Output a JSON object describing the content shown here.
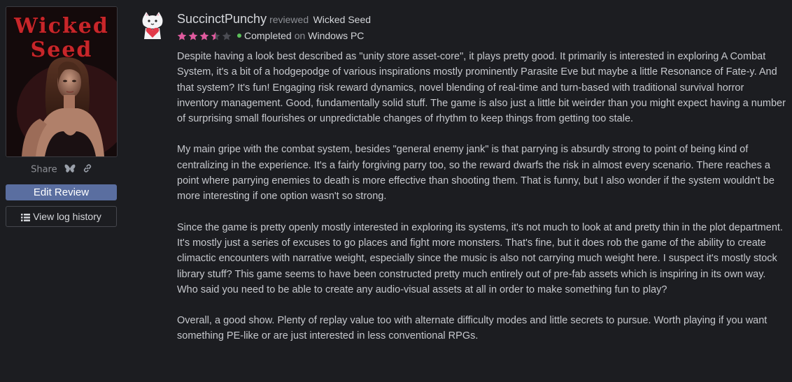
{
  "cover": {
    "title_line1": "Wicked",
    "title_line2": "Seed"
  },
  "share": {
    "label": "Share",
    "icons": [
      "butterfly-icon",
      "link-icon"
    ]
  },
  "actions": {
    "edit_review": "Edit Review",
    "view_log_history": "View log history"
  },
  "review": {
    "username": "SuccinctPunchy",
    "reviewed_label": "reviewed",
    "game": "Wicked Seed",
    "rating": 3.5,
    "rating_max": 5,
    "status": "Completed",
    "on_label": "on",
    "platform": "Windows PC",
    "status_color": "#5cbf5a",
    "star_color": "#e05a9e",
    "paragraphs": [
      "Despite having a look best described as \"unity store asset-core\", it plays pretty good. It primarily is interested in exploring A Combat System, it's a bit of a hodgepodge of various inspirations mostly prominently Parasite Eve but maybe a little Resonance of Fate-y. And that system? It's fun! Engaging risk reward dynamics, novel blending of real-time and turn-based with traditional survival horror inventory management. Good, fundamentally solid stuff. The game is also just a little bit weirder than you might expect having a number of surprising small flourishes or unpredictable changes of rhythm to keep things from getting too stale.",
      "My main gripe with the combat system, besides \"general enemy jank\" is that parrying is absurdly strong to point of being kind of centralizing in the experience. It's a fairly forgiving parry too, so the reward dwarfs the risk in almost every scenario. There reaches a point where parrying enemies to death is more effective than shooting them. That is funny, but I also wonder if the system wouldn't be more interesting if one option wasn't so strong.",
      "Since the game is pretty openly mostly interested in exploring its systems, it's not much to look at and pretty thin in the plot department. It's mostly just a series of excuses to go places and fight more monsters. That's fine, but it does rob the game of the ability to create climactic encounters with narrative weight, especially since the music is also not carrying much weight here. I suspect it's mostly stock library stuff? This game seems to have been constructed pretty much entirely out of pre-fab assets which is inspiring in its own way. Who said you need to be able to create any audio-visual assets at all in order to make something fun to play?",
      "Overall, a good show. Plenty of replay value too with alternate difficulty modes and little secrets to pursue. Worth playing if you want something PE-like or are just interested in less conventional RPGs."
    ]
  }
}
